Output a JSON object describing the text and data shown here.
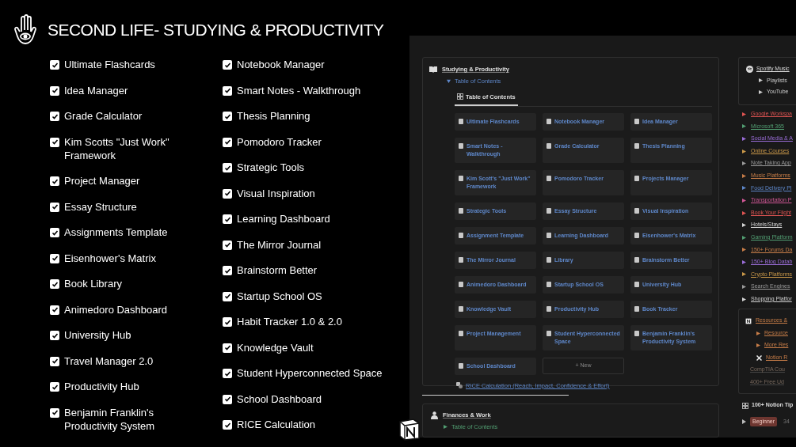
{
  "header": {
    "title": "SECOND LIFE- STUDYING & PRODUCTIVITY"
  },
  "checklist": {
    "columns": [
      [
        {
          "label": "Ultimate Flashcards",
          "checked": true
        },
        {
          "label": "Idea Manager",
          "checked": true
        },
        {
          "label": "Grade Calculator",
          "checked": true
        },
        {
          "label": "Kim Scotts \"Just Work\" Framework",
          "checked": true
        },
        {
          "label": "Project Manager",
          "checked": true
        },
        {
          "label": "Essay Structure",
          "checked": true
        },
        {
          "label": "Assignments Template",
          "checked": true
        },
        {
          "label": "Eisenhower's Matrix",
          "checked": true
        },
        {
          "label": "Book Library",
          "checked": true
        },
        {
          "label": "Animedoro Dashboard",
          "checked": true
        },
        {
          "label": "University Hub",
          "checked": true
        },
        {
          "label": "Travel Manager 2.0",
          "checked": true
        },
        {
          "label": "Productivity Hub",
          "checked": true
        },
        {
          "label": "Benjamin Franklin's Productivity System",
          "checked": true
        }
      ],
      [
        {
          "label": "Notebook Manager",
          "checked": true
        },
        {
          "label": "Smart Notes - Walkthrough",
          "checked": true
        },
        {
          "label": "Thesis Planning",
          "checked": true
        },
        {
          "label": "Pomodoro Tracker",
          "checked": true
        },
        {
          "label": "Strategic Tools",
          "checked": true
        },
        {
          "label": "Visual Inspiration",
          "checked": true
        },
        {
          "label": "Learning Dashboard",
          "checked": true
        },
        {
          "label": "The Mirror Journal",
          "checked": true
        },
        {
          "label": "Brainstorm Better",
          "checked": true
        },
        {
          "label": "Startup School OS",
          "checked": true
        },
        {
          "label": "Habit Tracker 1.0 & 2.0",
          "checked": true
        },
        {
          "label": "Knowledge Vault",
          "checked": true
        },
        {
          "label": "Student Hyperconnected Space",
          "checked": true
        },
        {
          "label": "School Dashboard",
          "checked": true
        },
        {
          "label": "RICE Calculation",
          "checked": true
        }
      ]
    ]
  },
  "notion": {
    "studying": {
      "title": "Studying & Productivity",
      "toggle": {
        "label": "Table of Contents",
        "expanded": true
      },
      "view_tab": "Table of Contents",
      "cards": [
        "Ultimate Flashcards",
        "Notebook Manager",
        "Idea Manager",
        "Smart Notes - Walkthrough",
        "Grade Calculator",
        "Thesis Planning",
        "Kim Scott's \"Just Work\" Framework",
        "Pomodoro Tracker",
        "Projects Manager",
        "Strategic Tools",
        "Essay Structure",
        "Visual Inspiration",
        "Assignment Template",
        "Learning Dashboard",
        "Eisenhower's Matrix",
        "The Mirror Journal",
        "Library",
        "Brainstorm Better",
        "Animedoro Dashboard",
        "Startup School OS",
        "University Hub",
        "Knowledge Vault",
        "Productivity Hub",
        "Book Tracker",
        "Project Management",
        "Student Hyperconnected Space",
        "Benjamin Franklin's Productivity System",
        "School Dashboard"
      ],
      "new_button": "+ New",
      "link": "RICE Calculation (Reach, Impact, Confidence & Effort)"
    },
    "finances": {
      "title": "Finances & Work",
      "toggle": {
        "label": "Table of Contents",
        "expanded": false
      }
    },
    "spotify": {
      "title": "Spotify Music",
      "items": [
        "Playlists",
        "YouTube"
      ]
    },
    "links": [
      {
        "label": "Google Workspa",
        "color": "#df5452"
      },
      {
        "label": "Microsoft 365",
        "color": "#529e72"
      },
      {
        "label": "Social Media & A",
        "color": "#9a6dd7"
      },
      {
        "label": "Online Courses",
        "color": "#ca9849"
      },
      {
        "label": "Note Taking App",
        "color": "#9b9b9b"
      },
      {
        "label": "Music Platforms",
        "color": "#c77d48"
      },
      {
        "label": "Food Delivery Pl",
        "color": "#5e87c9"
      },
      {
        "label": "Transportation P",
        "color": "#d15796"
      },
      {
        "label": "Book Your Flight",
        "color": "#df5452"
      },
      {
        "label": "Hotels/Stays",
        "color": "#d4d4d4"
      },
      {
        "label": "Gaming Platform",
        "color": "#529e72"
      },
      {
        "label": "150+ Forums Da",
        "color": "#c77d48"
      },
      {
        "label": "150+ Blog Datab",
        "color": "#9a6dd7"
      },
      {
        "label": "Crypto Platforms",
        "color": "#ca9849"
      },
      {
        "label": "Search Engines",
        "color": "#9b9b9b"
      },
      {
        "label": "Shopping Platfor",
        "color": "#d4d4d4"
      }
    ],
    "resources": {
      "title": "Resources &",
      "items": [
        {
          "kind": "toggle",
          "label": "Resource"
        },
        {
          "kind": "toggle",
          "label": "More Res"
        },
        {
          "kind": "tool",
          "label": "Notion R"
        },
        {
          "kind": "plain",
          "label": "CompTIA Cou"
        },
        {
          "kind": "plain",
          "label": "400+ Free Ud"
        }
      ]
    },
    "tips": {
      "title": "100+ Notion Tip",
      "tag": "Beginner",
      "count": "34"
    }
  }
}
